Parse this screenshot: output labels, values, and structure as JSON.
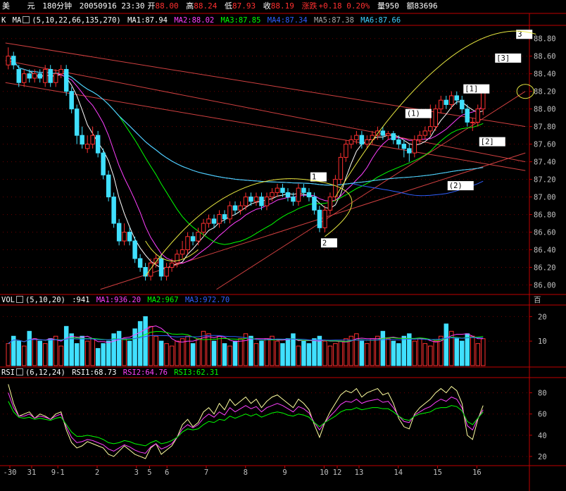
{
  "header": {
    "symbol": "美",
    "unit": "元",
    "period": "180分钟",
    "datetime": "20050916 23:30",
    "open_label": "开",
    "open": "88.00",
    "high_label": "高",
    "high": "88.24",
    "low_label": "低",
    "low": "87.93",
    "close_label": "收",
    "close": "88.19",
    "change_label": "涨跌",
    "change": "+0.18",
    "change_pct": "0.20%",
    "volume_label": "量",
    "volume": "950",
    "amount_label": "额",
    "amount": "83696"
  },
  "ma_line": {
    "k_label": "K",
    "name": "MA",
    "params": "(5,10,22,66,135,270)",
    "items": [
      {
        "label": "MA1:87.94",
        "color": "#ffffff"
      },
      {
        "label": "MA2:88.02",
        "color": "#ff40ff"
      },
      {
        "label": "MA3:87.85",
        "color": "#00ff00"
      },
      {
        "label": "MA4:87.34",
        "color": "#3060ff"
      },
      {
        "label": "MA5:87.38",
        "color": "#aaaaaa"
      },
      {
        "label": "MA6:87.66",
        "color": "#40d0ff"
      }
    ]
  },
  "vol_line": {
    "name": "VOL",
    "params": "(5,10,20)",
    "value": ":941",
    "items": [
      {
        "label": "MA1:936.20",
        "color": "#ff40ff"
      },
      {
        "label": "MA2:967",
        "color": "#00ff00"
      },
      {
        "label": "MA3:972.70",
        "color": "#3060ff"
      }
    ],
    "unit": "百"
  },
  "rsi_line": {
    "name": "RSI",
    "params": "(6,12,24)",
    "items": [
      {
        "label": "RSI1:68.73",
        "color": "#ffffff"
      },
      {
        "label": "RSI2:64.76",
        "color": "#ff40ff"
      },
      {
        "label": "RSI3:62.31",
        "color": "#00ff00"
      }
    ]
  },
  "colors": {
    "up": "#ff3030",
    "down": "#40e0ff",
    "axis": "#c00000",
    "tick_text": "#c0c0c0",
    "annotation_yellow": "#ffff40"
  },
  "chart_data": [
    {
      "type": "candlestick",
      "ylim": [
        85.9,
        88.95
      ],
      "y_ticks": [
        "88.80",
        "88.60",
        "88.40",
        "88.20",
        "88.00",
        "87.80",
        "87.60",
        "87.40",
        "87.20",
        "87.00",
        "86.80",
        "86.60",
        "86.40",
        "86.20",
        "86.00"
      ],
      "y_tick_values": [
        88.8,
        88.6,
        88.4,
        88.2,
        88.0,
        87.8,
        87.6,
        87.4,
        87.2,
        87.0,
        86.8,
        86.6,
        86.4,
        86.2,
        86.0
      ],
      "close": [
        88.6,
        88.5,
        88.3,
        88.4,
        88.35,
        88.4,
        88.35,
        88.45,
        88.3,
        88.4,
        88.45,
        88.2,
        88.0,
        87.7,
        87.6,
        87.6,
        87.7,
        87.5,
        87.25,
        87.0,
        86.7,
        86.5,
        86.6,
        86.5,
        86.3,
        86.2,
        86.1,
        86.25,
        86.3,
        86.1,
        86.2,
        86.25,
        86.35,
        86.4,
        86.55,
        86.5,
        86.6,
        86.7,
        86.75,
        86.7,
        86.8,
        86.75,
        86.9,
        86.85,
        86.9,
        87.0,
        86.95,
        87.0,
        86.9,
        87.0,
        87.05,
        87.1,
        87.05,
        87.0,
        86.95,
        87.1,
        87.05,
        87.0,
        86.85,
        86.65,
        86.85,
        87.0,
        87.2,
        87.45,
        87.6,
        87.65,
        87.7,
        87.6,
        87.65,
        87.7,
        87.75,
        87.7,
        87.72,
        87.65,
        87.6,
        87.55,
        87.5,
        87.65,
        87.7,
        87.75,
        87.8,
        88.0,
        88.1,
        88.05,
        88.15,
        88.1,
        88.0,
        87.85,
        87.85,
        88.0,
        88.19
      ],
      "open": [
        88.5,
        88.6,
        88.45,
        88.3,
        88.4,
        88.35,
        88.4,
        88.3,
        88.45,
        88.3,
        88.4,
        88.45,
        88.2,
        88.0,
        87.7,
        87.55,
        87.6,
        87.7,
        87.5,
        87.25,
        87.0,
        86.7,
        86.5,
        86.6,
        86.5,
        86.3,
        86.2,
        86.1,
        86.25,
        86.3,
        86.1,
        86.2,
        86.25,
        86.35,
        86.4,
        86.55,
        86.5,
        86.6,
        86.7,
        86.75,
        86.7,
        86.8,
        86.75,
        86.9,
        86.85,
        86.9,
        87.0,
        86.95,
        87.0,
        86.9,
        87.0,
        87.05,
        87.1,
        87.05,
        87.0,
        86.95,
        87.1,
        87.05,
        87.0,
        86.85,
        86.65,
        86.85,
        87.0,
        87.2,
        87.45,
        87.6,
        87.65,
        87.7,
        87.6,
        87.65,
        87.7,
        87.75,
        87.7,
        87.72,
        87.65,
        87.6,
        87.55,
        87.5,
        87.65,
        87.7,
        87.75,
        87.8,
        88.0,
        88.1,
        88.05,
        88.15,
        88.1,
        88.0,
        87.85,
        87.85,
        88.0
      ],
      "high": [
        88.7,
        88.65,
        88.5,
        88.45,
        88.45,
        88.45,
        88.45,
        88.5,
        88.5,
        88.45,
        88.5,
        88.5,
        88.25,
        88.05,
        87.8,
        87.7,
        87.8,
        87.75,
        87.55,
        87.3,
        87.05,
        86.75,
        86.7,
        86.65,
        86.55,
        86.35,
        86.25,
        86.3,
        86.35,
        86.35,
        86.25,
        86.3,
        86.4,
        86.5,
        86.6,
        86.6,
        86.65,
        86.75,
        86.8,
        86.8,
        86.85,
        86.85,
        86.95,
        86.95,
        86.95,
        87.05,
        87.05,
        87.05,
        87.05,
        87.05,
        87.1,
        87.15,
        87.15,
        87.1,
        87.05,
        87.15,
        87.15,
        87.1,
        87.05,
        86.9,
        86.9,
        87.05,
        87.25,
        87.5,
        87.65,
        87.7,
        87.75,
        87.75,
        87.7,
        87.75,
        87.8,
        87.8,
        87.75,
        87.75,
        87.7,
        87.65,
        87.6,
        87.7,
        87.75,
        87.8,
        88.05,
        88.05,
        88.15,
        88.15,
        88.2,
        88.2,
        88.15,
        88.05,
        87.9,
        88.05,
        88.24
      ],
      "low": [
        88.45,
        88.45,
        88.25,
        88.25,
        88.3,
        88.3,
        88.3,
        88.25,
        88.25,
        88.25,
        88.35,
        88.15,
        87.95,
        87.6,
        87.55,
        87.5,
        87.55,
        87.45,
        87.2,
        86.95,
        86.65,
        86.45,
        86.45,
        86.45,
        86.25,
        86.15,
        86.05,
        86.05,
        86.2,
        86.05,
        86.05,
        86.15,
        86.2,
        86.3,
        86.35,
        86.45,
        86.45,
        86.55,
        86.65,
        86.65,
        86.65,
        86.7,
        86.7,
        86.8,
        86.8,
        86.85,
        86.9,
        86.9,
        86.85,
        86.85,
        86.95,
        87.0,
        87.0,
        86.95,
        86.9,
        86.9,
        87.0,
        86.95,
        86.8,
        86.6,
        86.6,
        86.8,
        86.95,
        87.15,
        87.4,
        87.55,
        87.6,
        87.55,
        87.55,
        87.6,
        87.65,
        87.65,
        87.65,
        87.6,
        87.55,
        87.45,
        87.4,
        87.45,
        87.6,
        87.65,
        87.7,
        87.75,
        87.95,
        88.0,
        88.0,
        88.05,
        87.95,
        87.8,
        87.75,
        87.8,
        87.93
      ],
      "annotations": [
        "1",
        "2",
        "(1)",
        "(2)",
        "[1]",
        "[2]",
        "[3]",
        "3"
      ]
    },
    {
      "type": "bar",
      "name": "VOL",
      "ylim": [
        0,
        25
      ],
      "y_ticks": [
        "20",
        "10"
      ],
      "y_tick_values": [
        20,
        10
      ],
      "values": [
        9,
        12,
        10,
        8,
        14,
        11,
        10,
        9,
        11,
        12,
        8,
        16,
        13,
        9,
        12,
        10,
        11,
        7,
        9,
        10,
        13,
        14,
        11,
        10,
        15,
        18,
        20,
        16,
        12,
        10,
        9,
        8,
        10,
        11,
        12,
        9,
        11,
        14,
        13,
        10,
        12,
        9,
        8,
        10,
        11,
        13,
        12,
        9,
        10,
        11,
        12,
        10,
        9,
        11,
        13,
        8,
        10,
        9,
        11,
        12,
        10,
        8,
        9,
        10,
        11,
        12,
        13,
        10,
        9,
        11,
        12,
        14,
        11,
        10,
        9,
        12,
        13,
        10,
        11,
        9,
        8,
        10,
        12,
        17,
        14,
        11,
        10,
        13,
        12,
        9,
        11
      ]
    },
    {
      "type": "line",
      "name": "RSI",
      "ylim": [
        12,
        95
      ],
      "y_ticks": [
        "80",
        "60",
        "40",
        "20"
      ],
      "y_tick_values": [
        80,
        60,
        40,
        20
      ],
      "x_ticks": [
        "-30",
        "31",
        "9-1",
        "2",
        "3",
        "5",
        "6",
        "7",
        "8",
        "9",
        "10",
        "12",
        "13",
        "14",
        "15",
        "16"
      ],
      "series": [
        {
          "name": "RSI1",
          "values": [
            88,
            70,
            58,
            60,
            62,
            56,
            60,
            58,
            55,
            60,
            62,
            45,
            33,
            28,
            30,
            34,
            32,
            30,
            28,
            22,
            20,
            25,
            30,
            26,
            22,
            20,
            18,
            28,
            32,
            22,
            26,
            30,
            38,
            50,
            55,
            48,
            52,
            62,
            66,
            60,
            70,
            64,
            74,
            68,
            72,
            76,
            70,
            74,
            66,
            72,
            76,
            78,
            74,
            70,
            66,
            74,
            70,
            64,
            50,
            38,
            52,
            62,
            70,
            78,
            82,
            80,
            84,
            76,
            80,
            82,
            84,
            78,
            80,
            70,
            56,
            48,
            46,
            60,
            66,
            70,
            74,
            80,
            84,
            80,
            86,
            82,
            70,
            40,
            36,
            55,
            68
          ]
        },
        {
          "name": "RSI2",
          "values": [
            80,
            66,
            58,
            58,
            60,
            56,
            58,
            57,
            55,
            58,
            60,
            48,
            38,
            33,
            34,
            36,
            35,
            33,
            31,
            27,
            25,
            28,
            31,
            29,
            26,
            24,
            23,
            29,
            32,
            27,
            29,
            32,
            38,
            46,
            50,
            47,
            50,
            56,
            60,
            57,
            62,
            59,
            66,
            62,
            65,
            68,
            65,
            67,
            62,
            66,
            68,
            70,
            68,
            65,
            62,
            67,
            65,
            61,
            52,
            45,
            52,
            58,
            63,
            69,
            72,
            71,
            74,
            70,
            72,
            73,
            74,
            71,
            72,
            66,
            58,
            53,
            52,
            59,
            62,
            65,
            67,
            71,
            74,
            72,
            76,
            74,
            66,
            49,
            45,
            56,
            64
          ]
        },
        {
          "name": "RSI3",
          "values": [
            72,
            62,
            57,
            56,
            57,
            55,
            56,
            55,
            54,
            56,
            57,
            50,
            43,
            39,
            39,
            40,
            39,
            38,
            36,
            33,
            32,
            33,
            35,
            34,
            32,
            31,
            30,
            33,
            35,
            32,
            33,
            35,
            38,
            43,
            46,
            45,
            46,
            50,
            53,
            52,
            55,
            54,
            58,
            56,
            58,
            60,
            58,
            60,
            57,
            59,
            61,
            62,
            61,
            59,
            58,
            60,
            59,
            57,
            52,
            48,
            52,
            55,
            58,
            62,
            64,
            64,
            66,
            64,
            65,
            66,
            66,
            65,
            65,
            62,
            58,
            55,
            54,
            58,
            60,
            61,
            62,
            65,
            66,
            66,
            68,
            67,
            63,
            53,
            50,
            56,
            62
          ]
        }
      ]
    }
  ]
}
